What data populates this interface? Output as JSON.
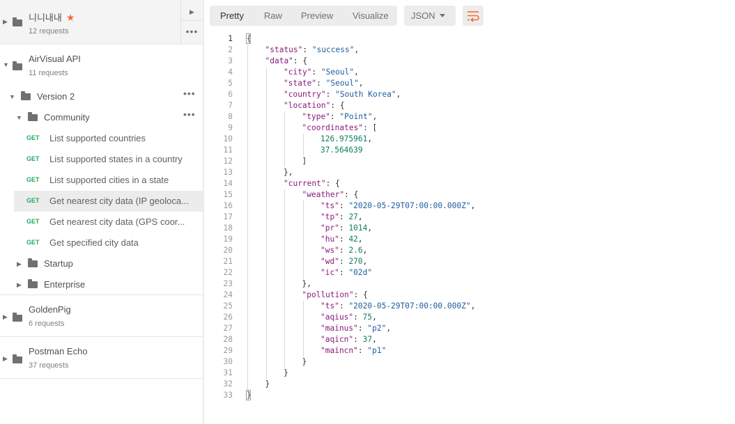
{
  "sidebar": {
    "collections": [
      {
        "name": "니니내내",
        "count": "12 requests",
        "favorite": true
      },
      {
        "name": "AirVisual API",
        "count": "11 requests"
      },
      {
        "name": "GoldenPig",
        "count": "6 requests"
      },
      {
        "name": "Postman Echo",
        "count": "37 requests"
      }
    ],
    "folders": {
      "version2": "Version 2",
      "community": "Community",
      "startup": "Startup",
      "enterprise": "Enterprise"
    },
    "requests": [
      {
        "method": "GET",
        "name": "List supported countries"
      },
      {
        "method": "GET",
        "name": "List supported states in a country"
      },
      {
        "method": "GET",
        "name": "List supported cities in a state"
      },
      {
        "method": "GET",
        "name": "Get nearest city data (IP geoloca..."
      },
      {
        "method": "GET",
        "name": "Get nearest city data (GPS coor..."
      },
      {
        "method": "GET",
        "name": "Get specified city data"
      }
    ],
    "icons": {
      "more": "more-dots-icon",
      "star": "star-icon",
      "folder": "folder-icon"
    }
  },
  "response": {
    "tabs": [
      "Pretty",
      "Raw",
      "Preview",
      "Visualize"
    ],
    "active_tab": "Pretty",
    "format": "JSON",
    "wrap_icon": "wrap-lines-icon",
    "colors": {
      "accent": "#f26b3a",
      "get": "#26a95f",
      "key": "#8a1a7a",
      "string": "#1d5c9c",
      "number": "#0f7d5e"
    },
    "lines": [
      {
        "n": "1",
        "indent": 0,
        "tokens": [
          [
            "p",
            "{"
          ]
        ]
      },
      {
        "n": "2",
        "indent": 1,
        "tokens": [
          [
            "k",
            "\"status\""
          ],
          [
            "p",
            ": "
          ],
          [
            "s",
            "\"success\""
          ],
          [
            "p",
            ","
          ]
        ]
      },
      {
        "n": "3",
        "indent": 1,
        "tokens": [
          [
            "k",
            "\"data\""
          ],
          [
            "p",
            ": {"
          ]
        ]
      },
      {
        "n": "4",
        "indent": 2,
        "tokens": [
          [
            "k",
            "\"city\""
          ],
          [
            "p",
            ": "
          ],
          [
            "s",
            "\"Seoul\""
          ],
          [
            "p",
            ","
          ]
        ]
      },
      {
        "n": "5",
        "indent": 2,
        "tokens": [
          [
            "k",
            "\"state\""
          ],
          [
            "p",
            ": "
          ],
          [
            "s",
            "\"Seoul\""
          ],
          [
            "p",
            ","
          ]
        ]
      },
      {
        "n": "6",
        "indent": 2,
        "tokens": [
          [
            "k",
            "\"country\""
          ],
          [
            "p",
            ": "
          ],
          [
            "s",
            "\"South Korea\""
          ],
          [
            "p",
            ","
          ]
        ]
      },
      {
        "n": "7",
        "indent": 2,
        "tokens": [
          [
            "k",
            "\"location\""
          ],
          [
            "p",
            ": {"
          ]
        ]
      },
      {
        "n": "8",
        "indent": 3,
        "tokens": [
          [
            "k",
            "\"type\""
          ],
          [
            "p",
            ": "
          ],
          [
            "s",
            "\"Point\""
          ],
          [
            "p",
            ","
          ]
        ]
      },
      {
        "n": "9",
        "indent": 3,
        "tokens": [
          [
            "k",
            "\"coordinates\""
          ],
          [
            "p",
            ": ["
          ]
        ]
      },
      {
        "n": "10",
        "indent": 4,
        "tokens": [
          [
            "n",
            "126.975961"
          ],
          [
            "p",
            ","
          ]
        ]
      },
      {
        "n": "11",
        "indent": 4,
        "tokens": [
          [
            "n",
            "37.564639"
          ]
        ]
      },
      {
        "n": "12",
        "indent": 3,
        "tokens": [
          [
            "p",
            "]"
          ]
        ]
      },
      {
        "n": "13",
        "indent": 2,
        "tokens": [
          [
            "p",
            "},"
          ]
        ]
      },
      {
        "n": "14",
        "indent": 2,
        "tokens": [
          [
            "k",
            "\"current\""
          ],
          [
            "p",
            ": {"
          ]
        ]
      },
      {
        "n": "15",
        "indent": 3,
        "tokens": [
          [
            "k",
            "\"weather\""
          ],
          [
            "p",
            ": {"
          ]
        ]
      },
      {
        "n": "16",
        "indent": 4,
        "tokens": [
          [
            "k",
            "\"ts\""
          ],
          [
            "p",
            ": "
          ],
          [
            "s",
            "\"2020-05-29T07:00:00.000Z\""
          ],
          [
            "p",
            ","
          ]
        ]
      },
      {
        "n": "17",
        "indent": 4,
        "tokens": [
          [
            "k",
            "\"tp\""
          ],
          [
            "p",
            ": "
          ],
          [
            "n",
            "27"
          ],
          [
            "p",
            ","
          ]
        ]
      },
      {
        "n": "18",
        "indent": 4,
        "tokens": [
          [
            "k",
            "\"pr\""
          ],
          [
            "p",
            ": "
          ],
          [
            "n",
            "1014"
          ],
          [
            "p",
            ","
          ]
        ]
      },
      {
        "n": "19",
        "indent": 4,
        "tokens": [
          [
            "k",
            "\"hu\""
          ],
          [
            "p",
            ": "
          ],
          [
            "n",
            "42"
          ],
          [
            "p",
            ","
          ]
        ]
      },
      {
        "n": "20",
        "indent": 4,
        "tokens": [
          [
            "k",
            "\"ws\""
          ],
          [
            "p",
            ": "
          ],
          [
            "n",
            "2.6"
          ],
          [
            "p",
            ","
          ]
        ]
      },
      {
        "n": "21",
        "indent": 4,
        "tokens": [
          [
            "k",
            "\"wd\""
          ],
          [
            "p",
            ": "
          ],
          [
            "n",
            "270"
          ],
          [
            "p",
            ","
          ]
        ]
      },
      {
        "n": "22",
        "indent": 4,
        "tokens": [
          [
            "k",
            "\"ic\""
          ],
          [
            "p",
            ": "
          ],
          [
            "s",
            "\"02d\""
          ]
        ]
      },
      {
        "n": "23",
        "indent": 3,
        "tokens": [
          [
            "p",
            "},"
          ]
        ]
      },
      {
        "n": "24",
        "indent": 3,
        "tokens": [
          [
            "k",
            "\"pollution\""
          ],
          [
            "p",
            ": {"
          ]
        ]
      },
      {
        "n": "25",
        "indent": 4,
        "tokens": [
          [
            "k",
            "\"ts\""
          ],
          [
            "p",
            ": "
          ],
          [
            "s",
            "\"2020-05-29T07:00:00.000Z\""
          ],
          [
            "p",
            ","
          ]
        ]
      },
      {
        "n": "26",
        "indent": 4,
        "tokens": [
          [
            "k",
            "\"aqius\""
          ],
          [
            "p",
            ": "
          ],
          [
            "n",
            "75"
          ],
          [
            "p",
            ","
          ]
        ]
      },
      {
        "n": "27",
        "indent": 4,
        "tokens": [
          [
            "k",
            "\"mainus\""
          ],
          [
            "p",
            ": "
          ],
          [
            "s",
            "\"p2\""
          ],
          [
            "p",
            ","
          ]
        ]
      },
      {
        "n": "28",
        "indent": 4,
        "tokens": [
          [
            "k",
            "\"aqicn\""
          ],
          [
            "p",
            ": "
          ],
          [
            "n",
            "37"
          ],
          [
            "p",
            ","
          ]
        ]
      },
      {
        "n": "29",
        "indent": 4,
        "tokens": [
          [
            "k",
            "\"maincn\""
          ],
          [
            "p",
            ": "
          ],
          [
            "s",
            "\"p1\""
          ]
        ]
      },
      {
        "n": "30",
        "indent": 3,
        "tokens": [
          [
            "p",
            "}"
          ]
        ]
      },
      {
        "n": "31",
        "indent": 2,
        "tokens": [
          [
            "p",
            "}"
          ]
        ]
      },
      {
        "n": "32",
        "indent": 1,
        "tokens": [
          [
            "p",
            "}"
          ]
        ]
      },
      {
        "n": "33",
        "indent": 0,
        "tokens": [
          [
            "p",
            "}"
          ]
        ]
      }
    ]
  }
}
